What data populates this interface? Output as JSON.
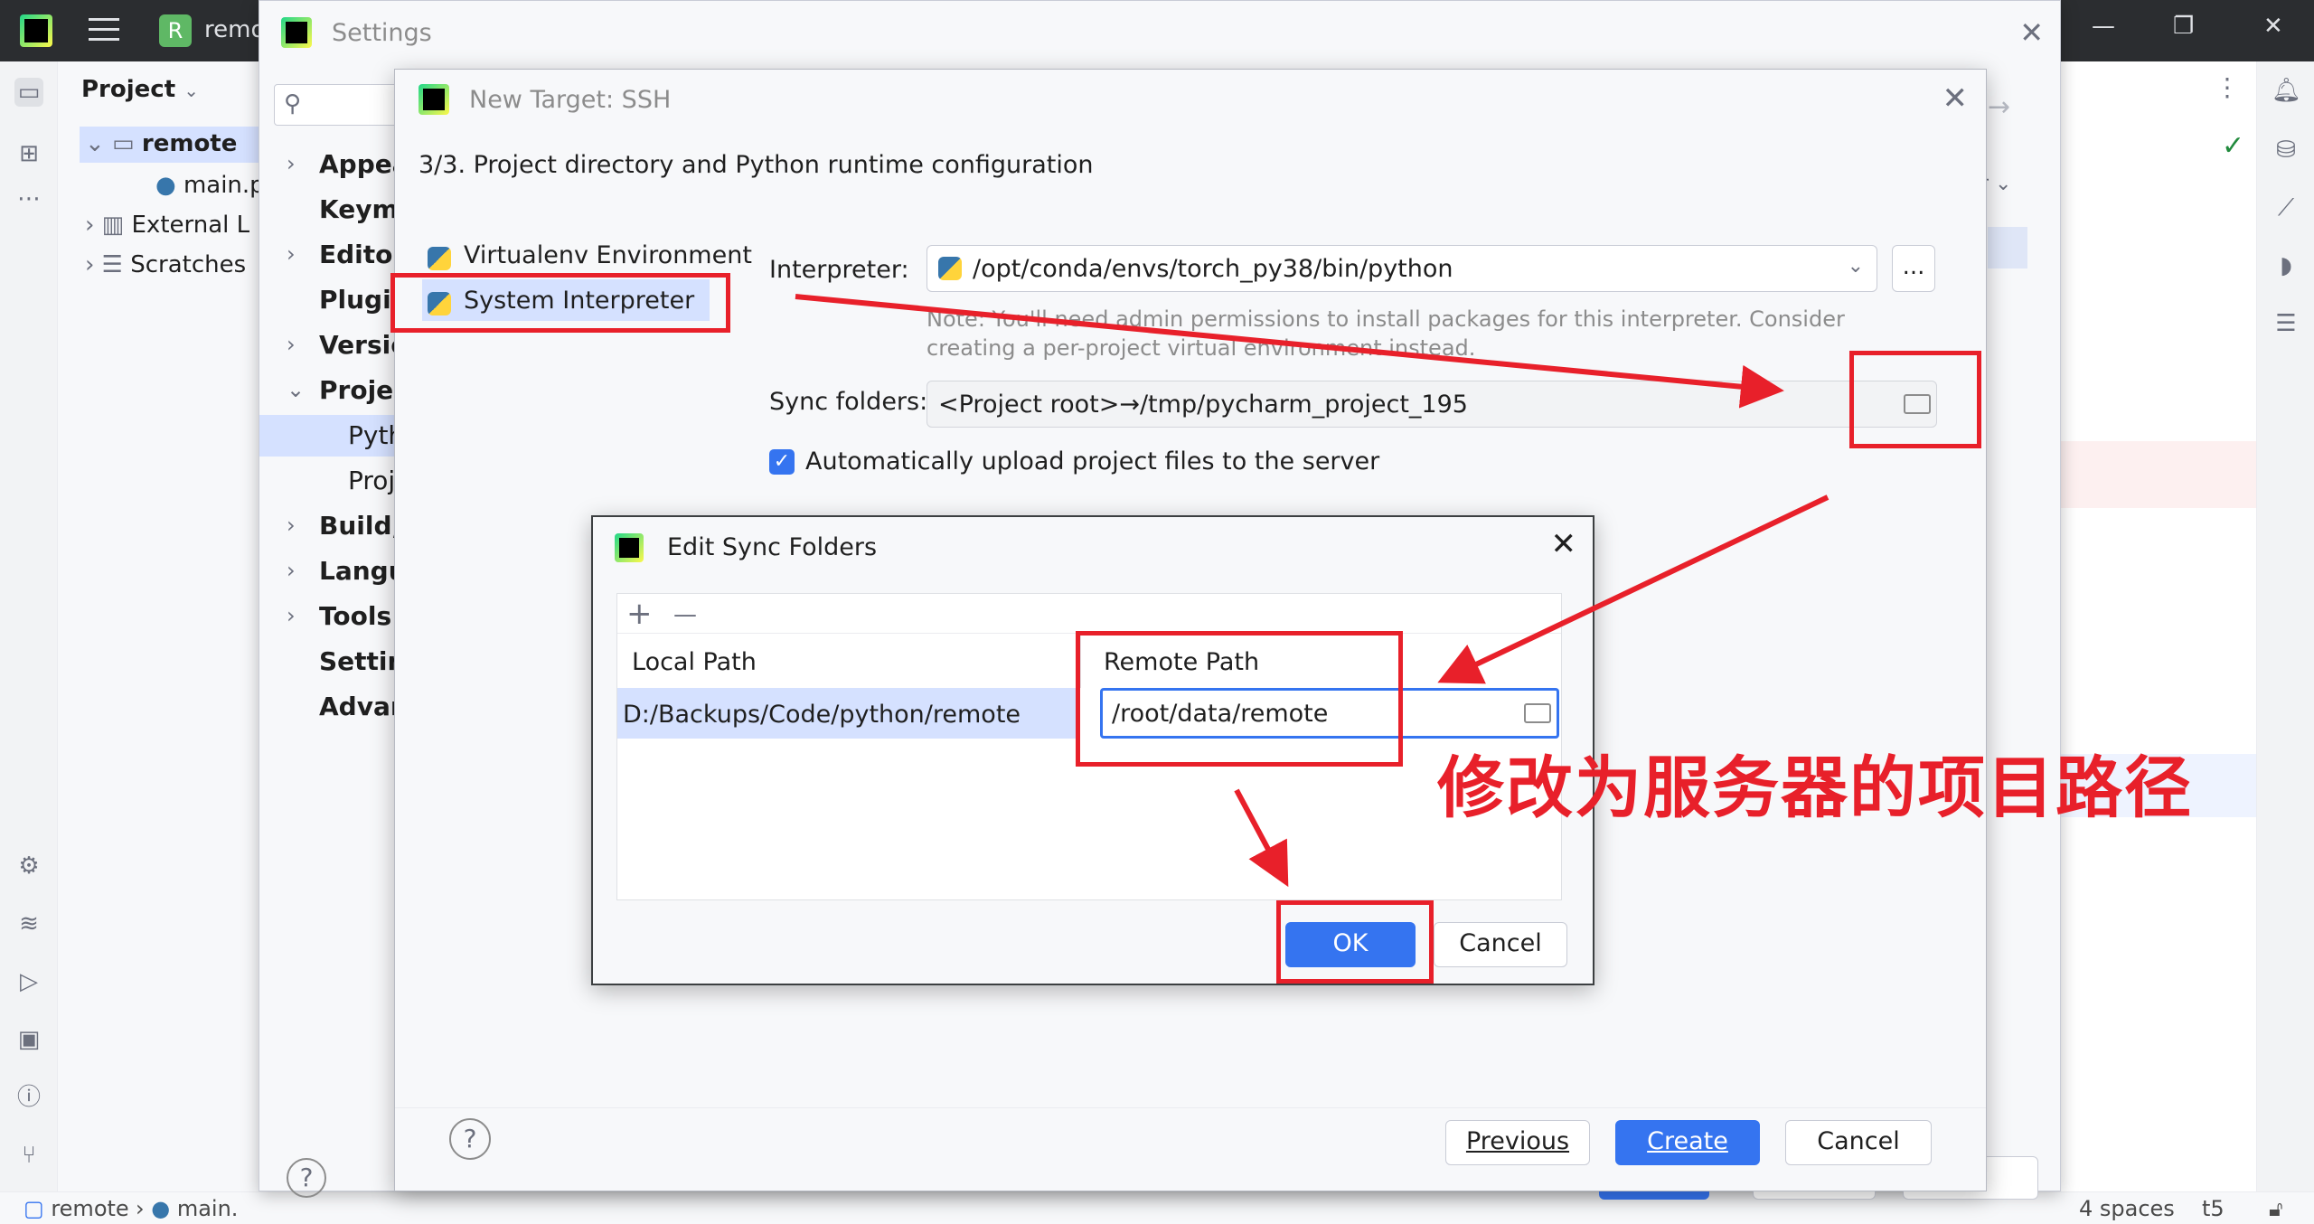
{
  "ide": {
    "project_badge": "R",
    "project_name": "remo",
    "panel_title": "Project",
    "tree": [
      {
        "label": "remote",
        "kind": "folder"
      },
      {
        "label": "main.p",
        "kind": "python-file"
      },
      {
        "label": "External L",
        "kind": "library"
      },
      {
        "label": "Scratches",
        "kind": "scratch"
      }
    ],
    "status": {
      "breadcrumb_root": "remote",
      "breadcrumb_file": "main.",
      "indent": "4 spaces",
      "encoding_fragment": "t5"
    }
  },
  "settings": {
    "title": "Settings",
    "search_placeholder": "",
    "nav": [
      "Appea",
      "Keyma",
      "Editor",
      "Plugin",
      "Versio",
      "Projec",
      "Pyth",
      "Proj",
      "Build, I",
      "Langu",
      "Tools",
      "Setting",
      "Advan"
    ]
  },
  "ssh_dialog": {
    "title": "New Target: SSH",
    "step": "3/3. Project directory and Python runtime configuration",
    "environments": [
      {
        "label": "Virtualenv Environment",
        "selected": false
      },
      {
        "label": "System Interpreter",
        "selected": true
      }
    ],
    "interpreter_label": "Interpreter:",
    "interpreter_value": "/opt/conda/envs/torch_py38/bin/python",
    "browse_label": "...",
    "note": "Note: You'll need admin permissions to install packages for this interpreter. Consider creating a per-project virtual environment instead.",
    "sync_label": "Sync folders:",
    "sync_value": "<Project root>→/tmp/pycharm_project_195",
    "auto_upload_label": "Automatically upload project files to the server",
    "auto_upload_checked": true,
    "buttons": {
      "previous": "Previous",
      "create": "Create",
      "cancel": "Cancel"
    },
    "help": "?"
  },
  "edit_sync": {
    "title": "Edit Sync Folders",
    "add": "+",
    "remove": "—",
    "col_local": "Local Path",
    "col_remote": "Remote Path",
    "local_value": "D:/Backups/Code/python/remote",
    "remote_value": "/root/data/remote",
    "ok": "OK",
    "cancel": "Cancel"
  },
  "annotation": {
    "text": "修改为服务器的项目路径",
    "color": "#e8202a"
  }
}
